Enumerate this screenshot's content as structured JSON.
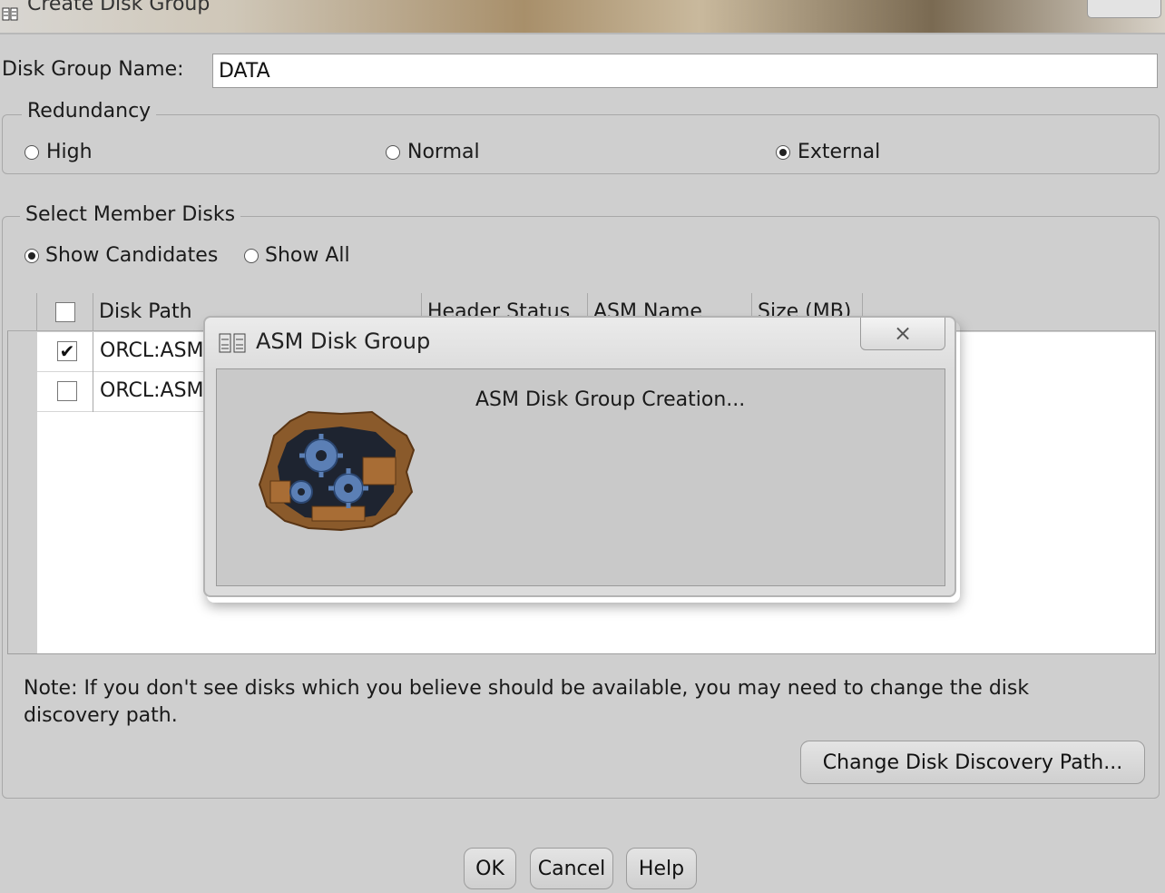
{
  "window": {
    "title": "Create Disk Group"
  },
  "disk_group": {
    "name_label": "Disk Group Name:",
    "name_value": "DATA"
  },
  "redundancy": {
    "legend": "Redundancy",
    "options": [
      {
        "label": "High",
        "selected": false
      },
      {
        "label": "Normal",
        "selected": false
      },
      {
        "label": "External",
        "selected": true
      }
    ]
  },
  "members": {
    "legend": "Select Member Disks",
    "filter_options": [
      {
        "label": "Show Candidates",
        "selected": true
      },
      {
        "label": "Show All",
        "selected": false
      }
    ],
    "table": {
      "columns": [
        "Disk Path",
        "Header Status",
        "ASM Name",
        "Size (MB)"
      ],
      "rows": [
        {
          "checked": true,
          "disk_path": "ORCL:ASM"
        },
        {
          "checked": false,
          "disk_path": "ORCL:ASM"
        }
      ]
    },
    "note": "Note: If you don't see disks which you believe should be available, you may need to change the disk discovery path.",
    "change_path_button": "Change Disk Discovery Path..."
  },
  "footer": {
    "ok_label": "OK",
    "cancel_label": "Cancel",
    "help_label": "Help"
  },
  "modal": {
    "title": "ASM Disk Group",
    "message": "ASM Disk Group Creation...",
    "close_glyph": "⨯"
  }
}
